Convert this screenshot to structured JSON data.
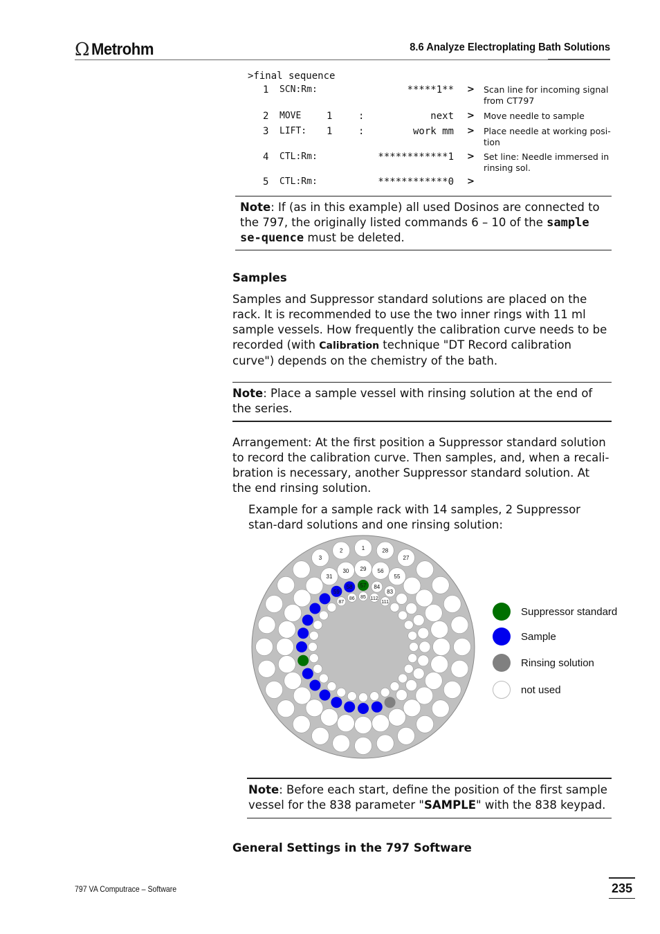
{
  "header": {
    "logo_symbol": "Ω",
    "brand": "Metrohm",
    "section_title": "8.6  Analyze Electroplating Bath Solutions"
  },
  "sequence": {
    "title": ">final sequence",
    "rows": [
      {
        "num": "1",
        "cmd": "SCN:Rm:",
        "arg": "",
        "colon": "",
        "value": "*****1**",
        "gt": ">",
        "desc": "Scan line for incoming signal from CT797"
      },
      {
        "num": "2",
        "cmd": "MOVE",
        "arg": "1",
        "colon": ":",
        "value": "next",
        "gt": ">",
        "desc": "Move needle to sample"
      },
      {
        "num": "3",
        "cmd": "LIFT:",
        "arg": "1",
        "colon": ":",
        "value": "work mm",
        "gt": ">",
        "desc": "Place needle at working posi-tion"
      },
      {
        "num": "4",
        "cmd": "CTL:Rm:",
        "arg": "",
        "colon": "",
        "value": "************1",
        "gt": ">",
        "desc": "Set line: Needle immersed in rinsing sol."
      },
      {
        "num": "5",
        "cmd": "CTL:Rm:",
        "arg": "",
        "colon": "",
        "value": "************0",
        "gt": ">",
        "desc": ""
      }
    ]
  },
  "note1": {
    "label": "Note",
    "text_a": ": If (as in this example) all used Dosinos are connected to the 797, the originally listed commands  6 – 10 of the ",
    "code": "sample se-quence",
    "text_b": "  must be deleted."
  },
  "samples": {
    "heading": "Samples",
    "text_a": "Samples and Suppressor standard solutions are placed on the rack. It is recommended to use the two inner rings with 11 ml sample vessels. How frequently the calibration curve needs to be recorded (with ",
    "bold": "Calibration",
    "text_b": " technique \"DT Record calibration curve\") depends on the chemistry of the bath."
  },
  "note2": {
    "label": "Note",
    "text": ": Place a sample vessel with rinsing solution at the end of the series."
  },
  "arrangement": "Arrangement: At the first position a Suppressor standard solution to record the calibration curve. Then samples, and, when a recali-bration is necessary, another Suppressor standard solution. At the end rinsing solution.",
  "example": "Example for a sample rack with 14 samples, 2 Suppressor stan-dard solutions and one rinsing solution:",
  "rack": {
    "rings": [
      {
        "first": 1,
        "last": 28,
        "labeled": [
          1,
          2,
          3,
          27,
          28
        ]
      },
      {
        "first": 29,
        "last": 56,
        "labeled": [
          29,
          30,
          31,
          55,
          56
        ]
      },
      {
        "first": 57,
        "last": 84,
        "labeled": [
          57,
          58,
          59,
          83,
          84
        ]
      },
      {
        "first": 85,
        "last": 112,
        "labeled": [
          85,
          86,
          87,
          111,
          112
        ]
      }
    ],
    "suppressor_standard": [
      57,
      65
    ],
    "sample": [
      58,
      59,
      60,
      61,
      62,
      63,
      64,
      66,
      67,
      68,
      69,
      70,
      71,
      72
    ],
    "rinsing": [
      73
    ],
    "colors": {
      "suppressor_standard": "#007000",
      "sample": "#0000ee",
      "rinsing": "#808080",
      "not_used": "#ffffff",
      "plate": "#c0c0c0"
    }
  },
  "legend": [
    {
      "key": "suppressor_standard",
      "label": "Suppressor standard"
    },
    {
      "key": "sample",
      "label": "Sample"
    },
    {
      "key": "rinsing",
      "label": "Rinsing solution"
    },
    {
      "key": "not_used",
      "label": "not used"
    }
  ],
  "note3": {
    "label": "Note",
    "text_a": ": Before each start, define the position of the first sample vessel for the 838 parameter \"",
    "bold": "SAMPLE",
    "text_b": "\" with the 838 keypad."
  },
  "general_heading": "General Settings in the 797 Software",
  "footer": {
    "text": "797 VA Computrace – Software",
    "page": "235"
  }
}
